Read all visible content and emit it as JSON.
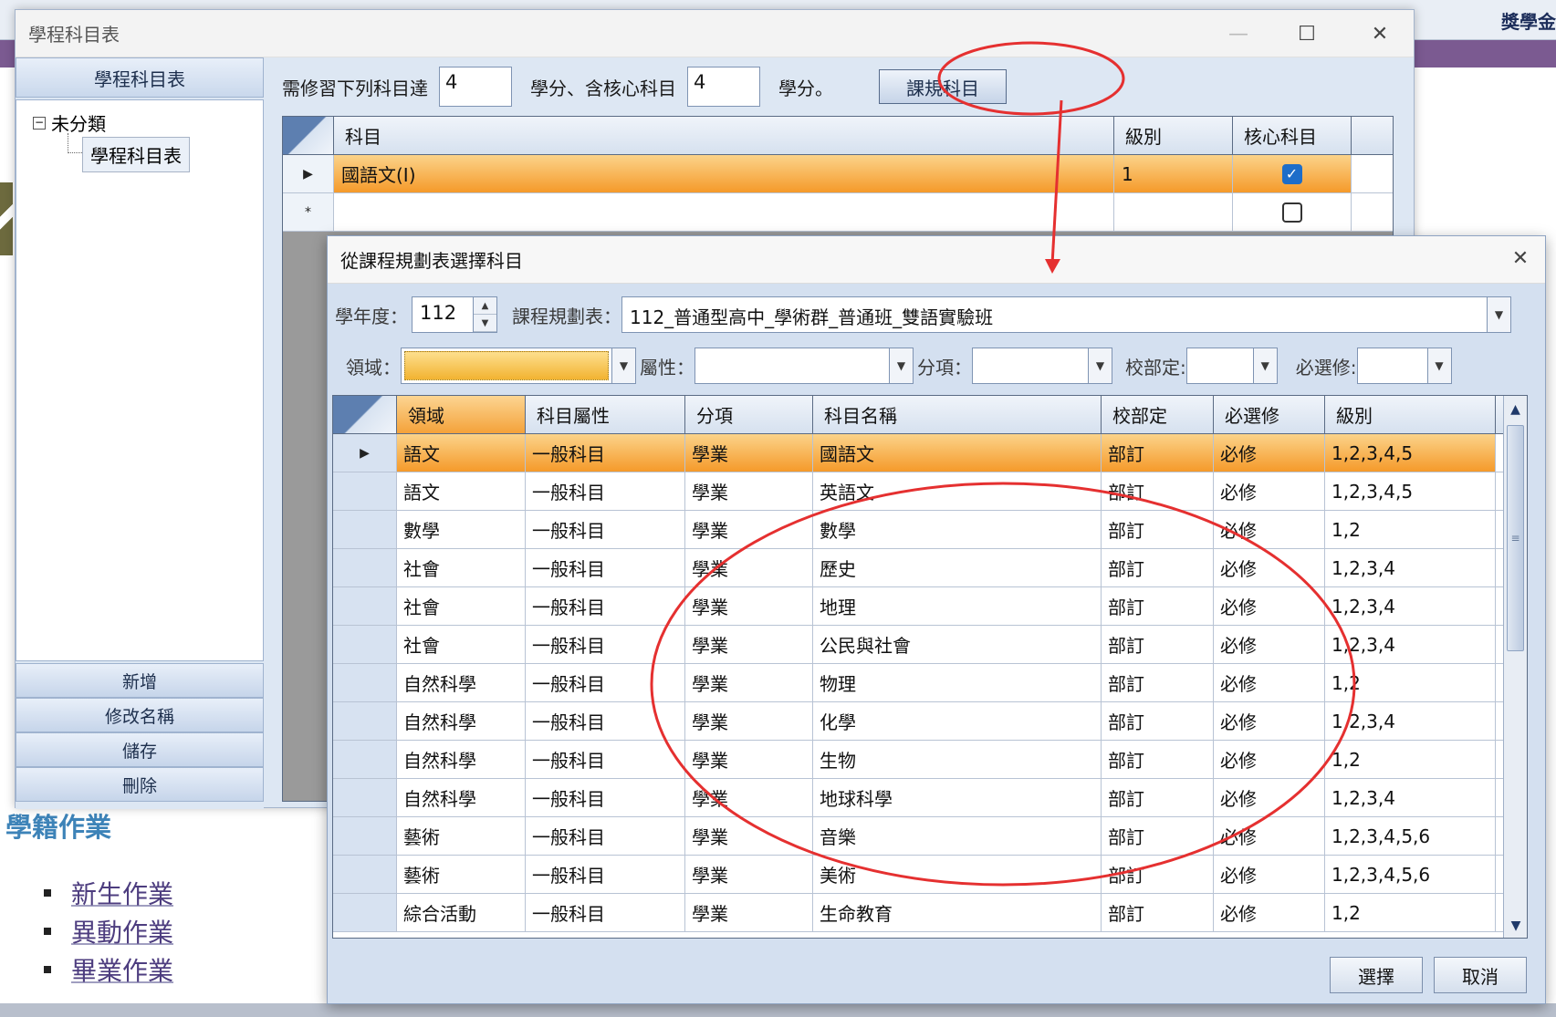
{
  "background": {
    "top_right_text": "獎學金",
    "heading": "學籍作業",
    "links": [
      "新生作業",
      "異動作業",
      "畢業作業"
    ]
  },
  "main_window": {
    "title": "學程科目表",
    "controls": {
      "minimize": "—",
      "maximize": "☐",
      "close": "✕"
    },
    "sidebar": {
      "header": "學程科目表",
      "tree": {
        "root_toggle": "−",
        "root": "未分類",
        "child": "學程科目表"
      },
      "buttons": [
        "新增",
        "修改名稱",
        "儲存",
        "刪除"
      ]
    },
    "requirement": {
      "label_before": "需修習下列科目達",
      "credits": "4",
      "label_middle": "學分、含核心科目",
      "core_credits": "4",
      "label_after": "學分。",
      "rule_button": "課規科目"
    },
    "grid": {
      "columns": [
        "科目",
        "級別",
        "核心科目"
      ],
      "rows": [
        {
          "marker": "▶",
          "subject": "國語文(I)",
          "level": "1",
          "core": true
        },
        {
          "marker": "*",
          "subject": "",
          "level": "",
          "core": false
        }
      ]
    }
  },
  "dialog": {
    "title": "從課程規劃表選擇科目",
    "close": "✕",
    "filters": {
      "school_year_label": "學年度：",
      "school_year": "112",
      "plan_label": "課程規劃表：",
      "plan": "112_普通型高中_學術群_普通班_雙語實驗班",
      "domain_label": "領域：",
      "attr_label": "屬性：",
      "item_label": "分項：",
      "school_label": "校部定:",
      "required_label": "必選修:"
    },
    "grid": {
      "columns": [
        "領域",
        "科目屬性",
        "分項",
        "科目名稱",
        "校部定",
        "必選修",
        "級別"
      ],
      "rows": [
        [
          "語文",
          "一般科目",
          "學業",
          "國語文",
          "部訂",
          "必修",
          "1,2,3,4,5"
        ],
        [
          "語文",
          "一般科目",
          "學業",
          "英語文",
          "部訂",
          "必修",
          "1,2,3,4,5"
        ],
        [
          "數學",
          "一般科目",
          "學業",
          "數學",
          "部訂",
          "必修",
          "1,2"
        ],
        [
          "社會",
          "一般科目",
          "學業",
          "歷史",
          "部訂",
          "必修",
          "1,2,3,4"
        ],
        [
          "社會",
          "一般科目",
          "學業",
          "地理",
          "部訂",
          "必修",
          "1,2,3,4"
        ],
        [
          "社會",
          "一般科目",
          "學業",
          "公民與社會",
          "部訂",
          "必修",
          "1,2,3,4"
        ],
        [
          "自然科學",
          "一般科目",
          "學業",
          "物理",
          "部訂",
          "必修",
          "1,2"
        ],
        [
          "自然科學",
          "一般科目",
          "學業",
          "化學",
          "部訂",
          "必修",
          "1,2,3,4"
        ],
        [
          "自然科學",
          "一般科目",
          "學業",
          "生物",
          "部訂",
          "必修",
          "1,2"
        ],
        [
          "自然科學",
          "一般科目",
          "學業",
          "地球科學",
          "部訂",
          "必修",
          "1,2,3,4"
        ],
        [
          "藝術",
          "一般科目",
          "學業",
          "音樂",
          "部訂",
          "必修",
          "1,2,3,4,5,6"
        ],
        [
          "藝術",
          "一般科目",
          "學業",
          "美術",
          "部訂",
          "必修",
          "1,2,3,4,5,6"
        ],
        [
          "綜合活動",
          "一般科目",
          "學業",
          "生命教育",
          "部訂",
          "必修",
          "1,2"
        ]
      ],
      "selected_marker": "▶"
    },
    "buttons": {
      "select": "選擇",
      "cancel": "取消"
    }
  },
  "colors": {
    "selected_row": "#f59a2a",
    "annotation": "#e53030",
    "checkbox_on": "#1d6dc9"
  }
}
